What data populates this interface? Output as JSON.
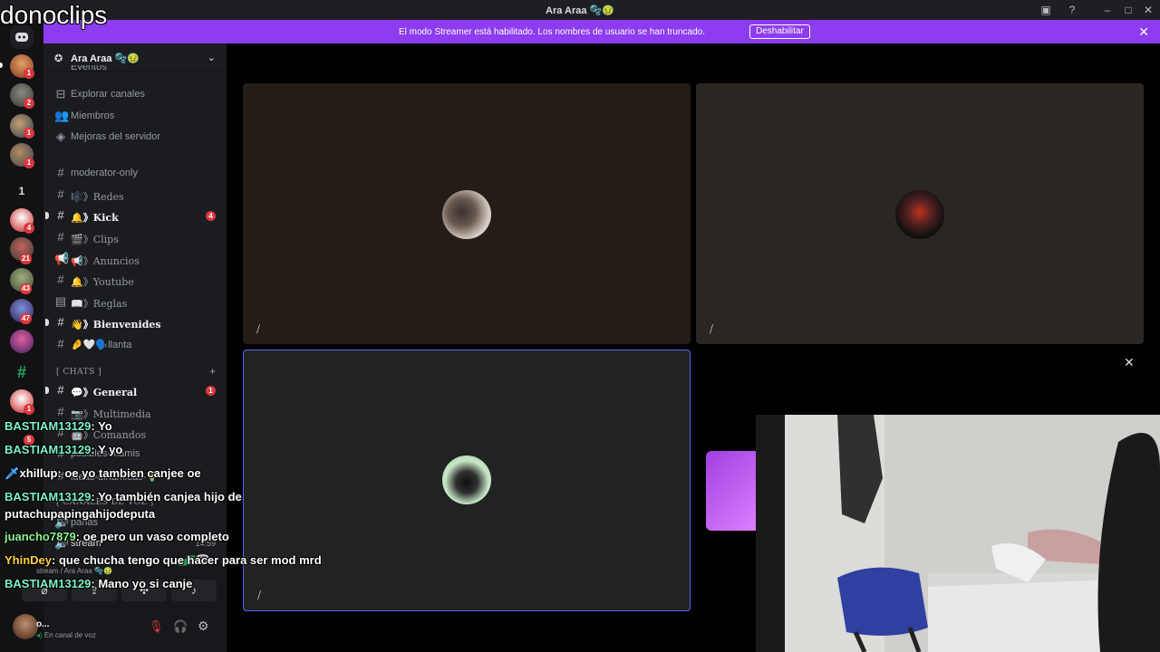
{
  "watermark": "donoclips",
  "window": {
    "title": "Ara Araa 🫧🤢"
  },
  "banner": {
    "message": "El modo Streamer está habilitado. Los nombres de usuario se han truncado.",
    "button": "Deshabilitar"
  },
  "rail": {
    "badges": [
      "1",
      "2",
      "1",
      "1",
      "4",
      "21",
      "43",
      "47",
      "1",
      "5"
    ],
    "folder_label": "1"
  },
  "server": {
    "name": "Ara Araa 🫧🤢"
  },
  "sidebar": {
    "top_items": [
      {
        "label": "Eventos",
        "icon": "calendar-icon"
      },
      {
        "label": "Explorar canales",
        "icon": "compass-icon"
      },
      {
        "label": "Miembros",
        "icon": "members-icon"
      },
      {
        "label": "Mejoras del servidor",
        "icon": "boost-icon"
      }
    ],
    "channels": [
      {
        "label": "moderator-only"
      },
      {
        "label": "🎼》Redes"
      },
      {
        "label": "🔔》Kick",
        "badge": "4"
      },
      {
        "label": "🎬》Clips"
      },
      {
        "label": "📢》Anuncios"
      },
      {
        "label": "🔔》Youtube"
      },
      {
        "label": "📖》Reglas"
      },
      {
        "label": "👋》Bienvenides"
      },
      {
        "label": "🤌🤍🗣️llanta"
      }
    ],
    "category_chats": "[ CHATS ]",
    "chat_channels": [
      {
        "label": "💬》General",
        "badge": "1"
      },
      {
        "label": "📷》Multimedia"
      },
      {
        "label": "🤖》Comandos"
      },
      {
        "label": "posibles-mamis"
      },
      {
        "label": "ideas-dinamicas-💡"
      }
    ],
    "category_voice": "[ CANALES DE VOZ ]",
    "voice_channels": [
      {
        "label": "panas"
      },
      {
        "label": "stream"
      }
    ],
    "voice_time": "14:59",
    "voice_path": "stream / Ara Araa 🫧🤢"
  },
  "user": {
    "name": "o...",
    "status": "En canal de voz"
  },
  "chat": [
    {
      "user": "BASTIAM13129",
      "color": "#7cf5c9",
      "text": "Yo"
    },
    {
      "user": "BASTIAM13129",
      "color": "#7cf5c9",
      "text": "Y yo"
    },
    {
      "user": "xhillup",
      "color": "#ffffff",
      "text": "oe yo tambien canjee oe"
    },
    {
      "user": "BASTIAM13129",
      "color": "#7cf5c9",
      "text": "Yo también canjea hijo de putachupapingahijodeputa"
    },
    {
      "user": "juancho7879",
      "color": "#8ff58f",
      "text": "oe pero un vaso completo"
    },
    {
      "user": "YhinDey",
      "color": "#ffd23a",
      "text": "que chucha tengo que hacer para ser mod mrd"
    },
    {
      "user": "BASTIAM13129",
      "color": "#7cf5c9",
      "text": "Mano yo si canje"
    }
  ]
}
